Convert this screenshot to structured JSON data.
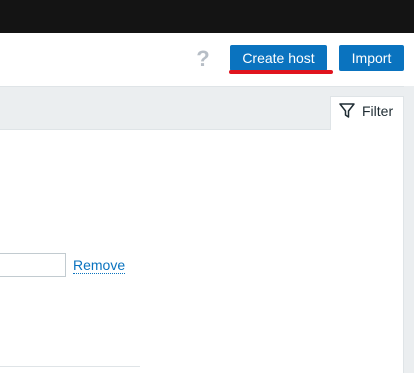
{
  "header": {
    "help_icon": "question-mark-icon",
    "help_text": "?",
    "create_host_label": "Create host",
    "import_label": "Import",
    "accent_color": "#0a73bf",
    "highlight_color": "#e0141e"
  },
  "filter": {
    "icon": "funnel-icon",
    "label": "Filter"
  },
  "form": {
    "input_value": "",
    "remove_label": "Remove"
  }
}
